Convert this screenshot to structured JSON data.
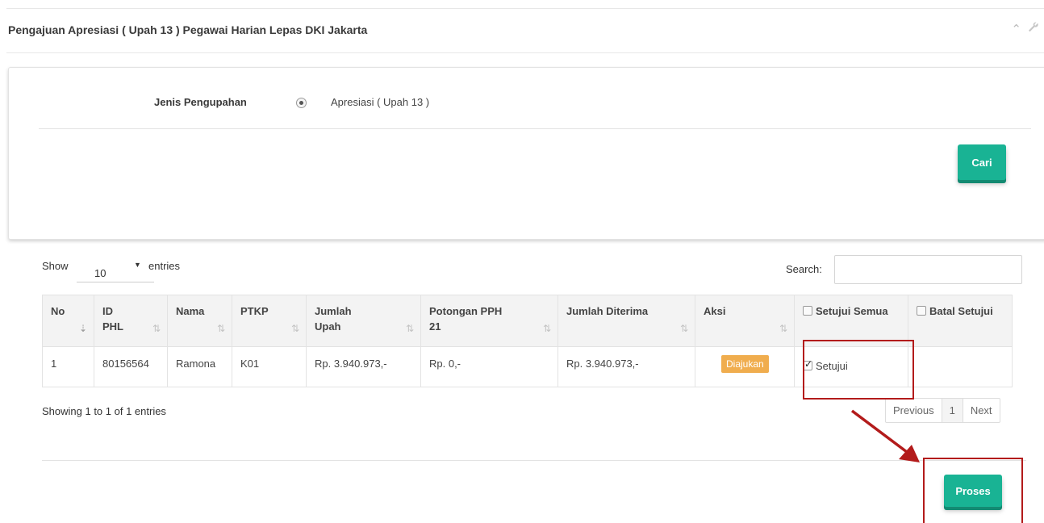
{
  "panel": {
    "title": "Pengajuan Apresiasi ( Upah 13 ) Pegawai Harian Lepas DKI Jakarta",
    "collapse_icon": "chevron-up-icon",
    "settings_icon": "wrench-icon"
  },
  "filter": {
    "label": "Jenis Pengupahan",
    "option_label": "Apresiasi ( Upah 13 )",
    "option_selected": true,
    "search_button": "Cari"
  },
  "table_controls": {
    "show_label": "Show",
    "entries_value": "10",
    "entries_label": "entries",
    "search_label": "Search:",
    "search_value": ""
  },
  "table": {
    "headers": [
      "No",
      "ID PHL",
      "Nama",
      "PTKP",
      "Jumlah Upah",
      "Potongan PPH 21",
      "Jumlah Diterima",
      "Aksi"
    ],
    "header_lines": {
      "id": [
        "ID",
        "PHL"
      ],
      "jumlah_upah": [
        "Jumlah",
        "Upah"
      ],
      "pph": [
        "Potongan PPH",
        "21"
      ]
    },
    "approve_all_label": "Setujui Semua",
    "cancel_all_label": "Batal Setujui",
    "rows": [
      {
        "no": "1",
        "id_phl": "80156564",
        "nama": "Ramona",
        "ptkp": "K01",
        "jumlah_upah": "Rp. 3.940.973,-",
        "potongan_pph": "Rp. 0,-",
        "jumlah_diterima": "Rp. 3.940.973,-",
        "status": "Diajukan",
        "approve_label": "Setujui",
        "approve_checked": true
      }
    ]
  },
  "pagination": {
    "info": "Showing 1 to 1 of 1 entries",
    "previous": "Previous",
    "current": "1",
    "next": "Next"
  },
  "actions": {
    "process_button": "Proses"
  },
  "colors": {
    "primary": "#19b394",
    "badge": "#f0ad4e",
    "annotation": "#b31b1b"
  }
}
